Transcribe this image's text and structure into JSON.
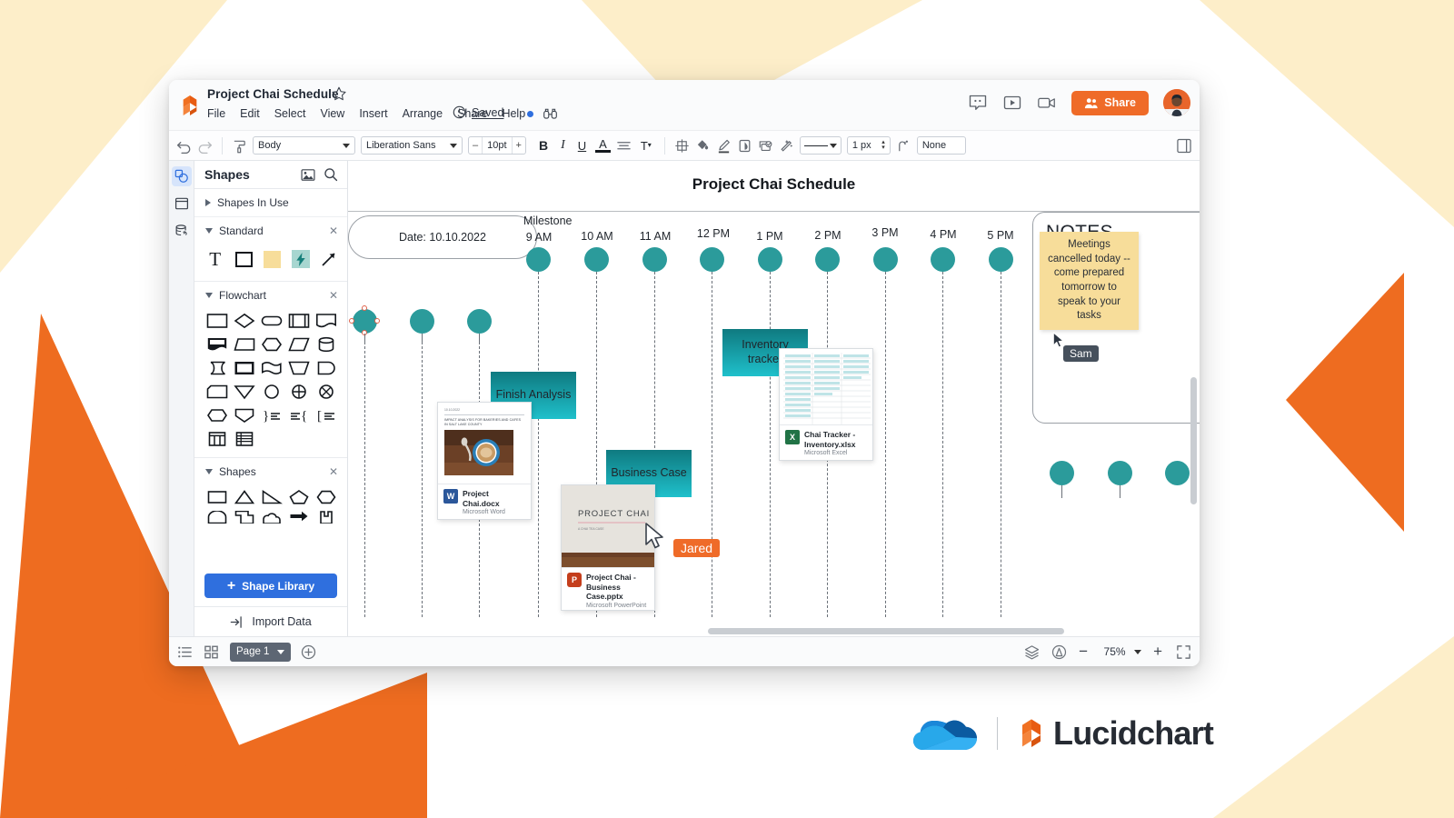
{
  "window": {
    "doc_title": "Project Chai Schedule",
    "star_icon": "star-outline-icon",
    "lucid_logo_icon": "lucid-mark-icon",
    "menus": [
      "File",
      "Edit",
      "Select",
      "View",
      "Insert",
      "Arrange",
      "Share",
      "Help"
    ],
    "help_dot_color": "#2f6fde",
    "binoculars_icon": "binoculars-icon",
    "save_status": "Saved",
    "save_clock_icon": "clock-icon",
    "right_icons": [
      "comment-icon",
      "present-icon",
      "video-camera-icon"
    ],
    "share_label": "Share",
    "share_color": "#ef6b28",
    "avatar_name": "user-avatar"
  },
  "format_toolbar": {
    "undo_icon": "undo-icon",
    "redo_icon": "redo-icon",
    "format_painter_icon": "format-painter-icon",
    "text_style": "Body",
    "font_family": "Liberation Sans",
    "font_size": "10pt",
    "decrease_label": "–",
    "increase_label": "+",
    "bold_label": "B",
    "italic_label": "I",
    "underline_label": "U",
    "text_color_label": "A",
    "align_icon": "align-icon",
    "text_options_label": "T",
    "shape_icons": [
      "frame-icon",
      "fill-bucket-icon",
      "line-color-icon",
      "shadow-icon",
      "theme-icon",
      "magic-wand-icon"
    ],
    "line_style": "line-style-select",
    "line_width": "1 px",
    "line_jump_icon": "line-jump-icon",
    "arrow_end": "None",
    "right_panel_icon": "right-panel-icon"
  },
  "left_rail": [
    {
      "name": "shapes-rail-button",
      "icon": "shapes-icon",
      "active": true
    },
    {
      "name": "templates-rail-button",
      "icon": "template-icon",
      "active": false
    },
    {
      "name": "data-rail-button",
      "icon": "data-link-icon",
      "active": false
    }
  ],
  "shapes_panel": {
    "title": "Shapes",
    "image_icon": "image-icon",
    "search_icon": "search-icon",
    "sections": [
      {
        "label": "Shapes In Use",
        "expanded": false,
        "closable": false
      },
      {
        "label": "Standard",
        "expanded": true,
        "closable": true
      },
      {
        "label": "Flowchart",
        "expanded": true,
        "closable": true
      },
      {
        "label": "Shapes",
        "expanded": true,
        "closable": true
      }
    ],
    "standard_shapes": [
      "text-shape",
      "rectangle-shape",
      "sticky-note-shape",
      "hotspot-shape",
      "arrow-line-shape"
    ],
    "shape_library_label": "Shape Library",
    "shape_library_plus": "+",
    "import_data_label": "Import Data",
    "import_data_icon": "import-icon"
  },
  "canvas": {
    "title": "Project Chai Schedule",
    "date_pill": "Date: 10.10.2022",
    "milestone_label": "Milestone",
    "time_ticks": [
      "9 AM",
      "10 AM",
      "11 AM",
      "12 PM",
      "1 PM",
      "2 PM",
      "3 PM",
      "4 PM",
      "5 PM"
    ],
    "node_color": "#2b9b9b",
    "task_boxes": [
      {
        "label": "Finish Analysis",
        "name": "task-finish-analysis"
      },
      {
        "label": "Business Case",
        "name": "task-business-case"
      },
      {
        "label": "Inventory tracker",
        "name": "task-inventory-tracker"
      }
    ],
    "notes": {
      "title": "NOTES",
      "sticky_text": "Meetings cancelled today -- come prepared tomorrow to speak to your tasks",
      "sticky_color": "#f7dd9a",
      "cursor_label": "Sam",
      "cursor_color": "#46505c"
    },
    "collaborator_cursor": {
      "label": "Jared",
      "color": "#ef6b28"
    },
    "file_cards": [
      {
        "name": "file-card-project-chai-docx",
        "filename": "Project Chai.docx",
        "app": "Microsoft Word",
        "icon_letter": "W",
        "icon_color": "#2b579a",
        "preview_date": "10.10.2022",
        "preview_heading": "IMPACT ANALYSIS FOR BAKERIES AND CAFES IN SALT LAKE COUNTY"
      },
      {
        "name": "file-card-business-case-pptx",
        "filename": "Project Chai - Business Case.pptx",
        "app": "Microsoft PowerPoint",
        "icon_letter": "P",
        "icon_color": "#c43e1c",
        "preview_heading": "PROJECT CHAI",
        "preview_sub": "A CHAI TEA CASE"
      },
      {
        "name": "file-card-inventory-xlsx",
        "filename": "Chai Tracker - Inventory.xlsx",
        "app": "Microsoft Excel",
        "icon_letter": "X",
        "icon_color": "#217346"
      }
    ]
  },
  "statusbar": {
    "layers_list_icon": "outline-list-icon",
    "grid_icon": "grid-view-icon",
    "page_label": "Page 1",
    "add_page_icon": "add-page-icon",
    "layers_icon": "layers-icon",
    "accessibility_icon": "accessibility-icon",
    "zoom_out_label": "−",
    "zoom_level": "75%",
    "zoom_in_label": "+",
    "fullscreen_icon": "fullscreen-icon"
  },
  "footer": {
    "onedrive_icon": "onedrive-cloud-icon",
    "brand": "Lucidchart",
    "brand_mark_icon": "lucid-mark-icon"
  },
  "background": {
    "cream": "#fdeec9",
    "orange": "#ee6c20"
  }
}
